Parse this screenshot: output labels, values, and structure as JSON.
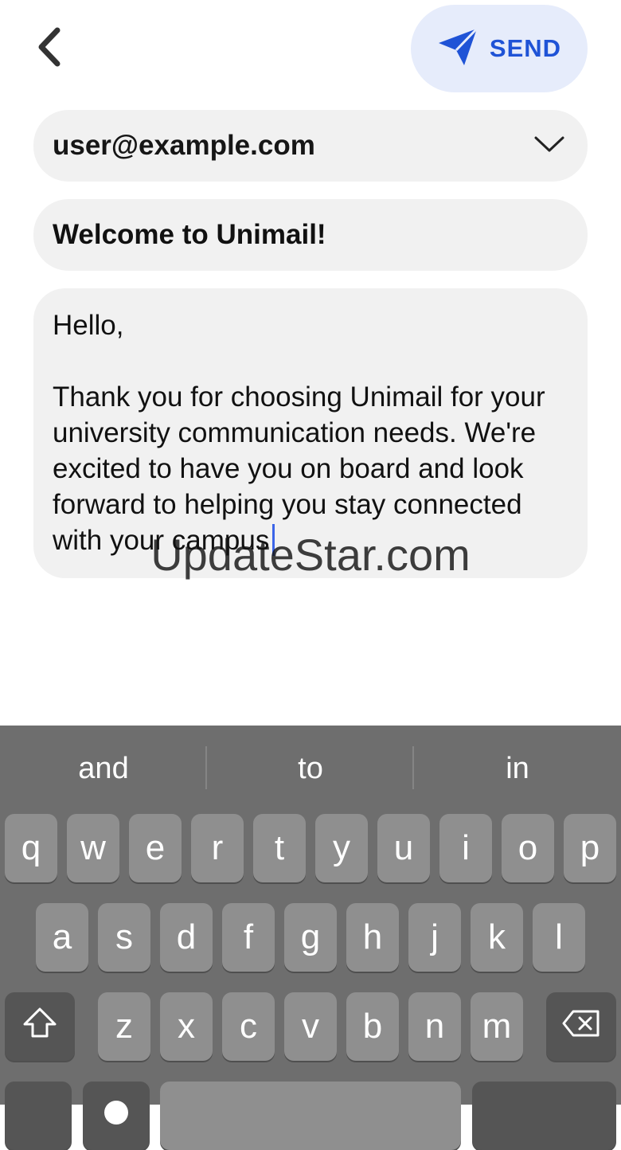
{
  "header": {
    "back_icon": "chevron-left-icon",
    "send_icon": "paper-plane-icon",
    "send_label": "SEND",
    "accent_color": "#1f53d6"
  },
  "compose": {
    "to_value": "user@example.com",
    "to_dropdown_icon": "chevron-down-icon",
    "subject": "Welcome to Unimail!",
    "body": "Hello,\n\nThank you for choosing Unimail for your university communication needs. We're excited to have you on board and look forward to helping you stay connected with your campus"
  },
  "watermark": "UpdateStar.com",
  "keyboard": {
    "suggestions": [
      "and",
      "to",
      "in"
    ],
    "row1": [
      "q",
      "w",
      "e",
      "r",
      "t",
      "y",
      "u",
      "i",
      "o",
      "p"
    ],
    "row2": [
      "a",
      "s",
      "d",
      "f",
      "g",
      "h",
      "j",
      "k",
      "l"
    ],
    "row3": [
      "z",
      "x",
      "c",
      "v",
      "b",
      "n",
      "m"
    ],
    "shift_icon": "shift-icon",
    "backspace_icon": "backspace-icon"
  }
}
